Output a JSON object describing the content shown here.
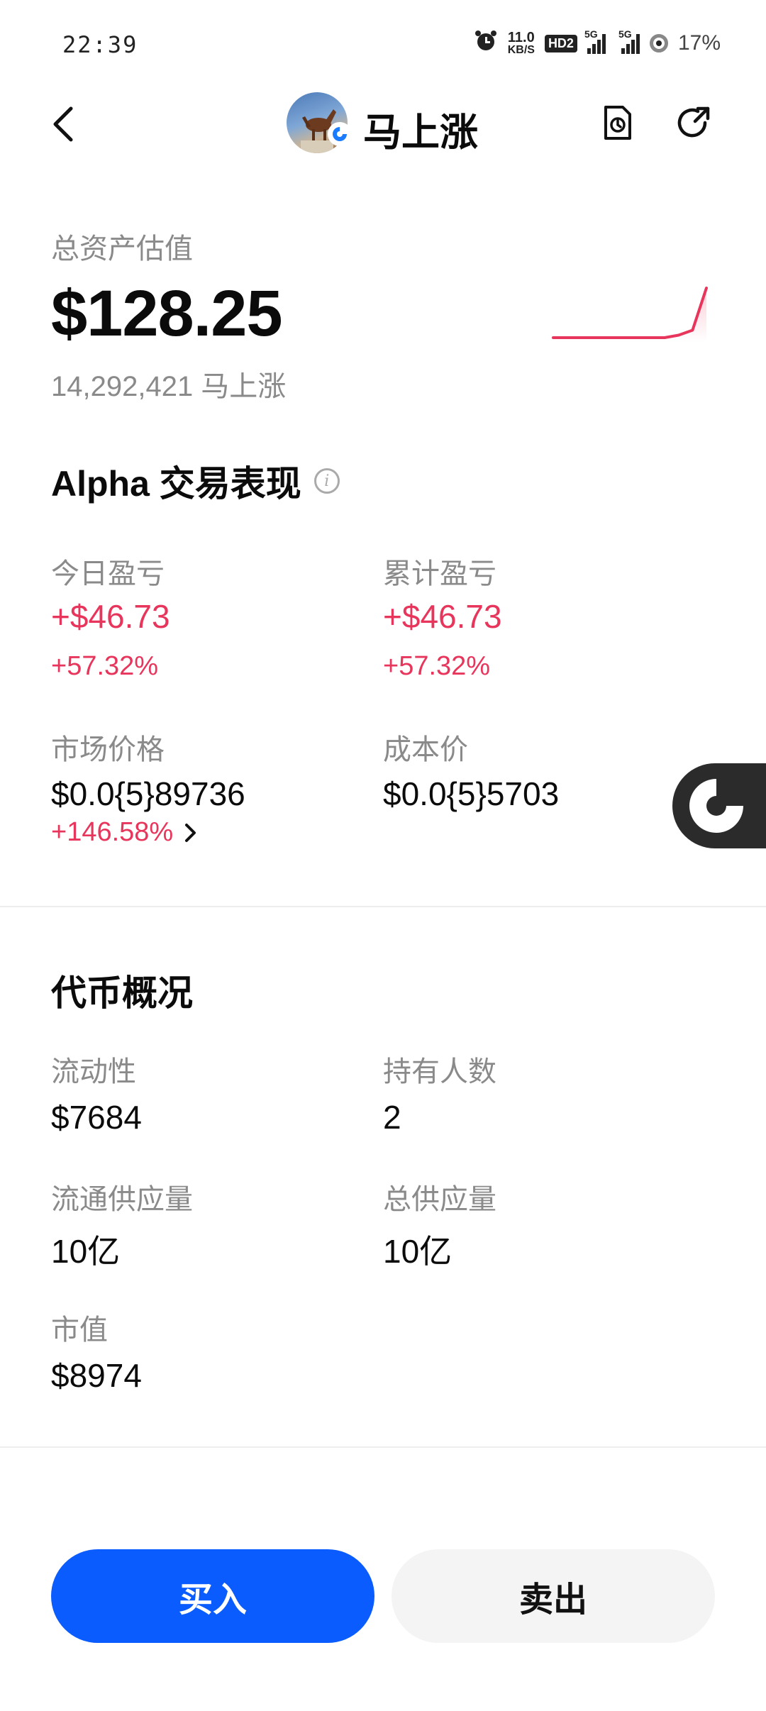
{
  "status_bar": {
    "time": "22:39",
    "net_speed_value": "11.0",
    "net_speed_unit": "KB/S",
    "hd_badge": "HD2",
    "signal_1": "5G",
    "signal_2": "5G",
    "battery": "17%"
  },
  "header": {
    "title": "马上涨"
  },
  "assets": {
    "label": "总资产估值",
    "value": "$128.25",
    "token_amount": "14,292,421 马上涨",
    "sparkline": [
      0,
      0,
      0,
      0,
      0,
      0,
      0,
      0,
      0,
      0.05,
      0.15,
      1
    ]
  },
  "alpha": {
    "title": "Alpha 交易表现",
    "today_pnl_label": "今日盈亏",
    "today_pnl_value": "+$46.73",
    "today_pnl_pct": "+57.32%",
    "total_pnl_label": "累计盈亏",
    "total_pnl_value": "+$46.73",
    "total_pnl_pct": "+57.32%",
    "market_price_label": "市场价格",
    "market_price_value": "$0.0{5}89736",
    "market_price_change": "+146.58%",
    "cost_price_label": "成本价",
    "cost_price_value": "$0.0{5}5703"
  },
  "token_overview": {
    "title": "代币概况",
    "liquidity_label": "流动性",
    "liquidity_value": "$7684",
    "holders_label": "持有人数",
    "holders_value": "2",
    "circulating_label": "流通供应量",
    "circulating_value": "10亿",
    "total_supply_label": "总供应量",
    "total_supply_value": "10亿",
    "market_cap_label": "市值",
    "market_cap_value": "$8974"
  },
  "actions": {
    "buy": "买入",
    "sell": "卖出"
  },
  "colors": {
    "positive": "#e8355c",
    "buy_button": "#0a5cff",
    "sell_button": "#f4f4f4"
  }
}
